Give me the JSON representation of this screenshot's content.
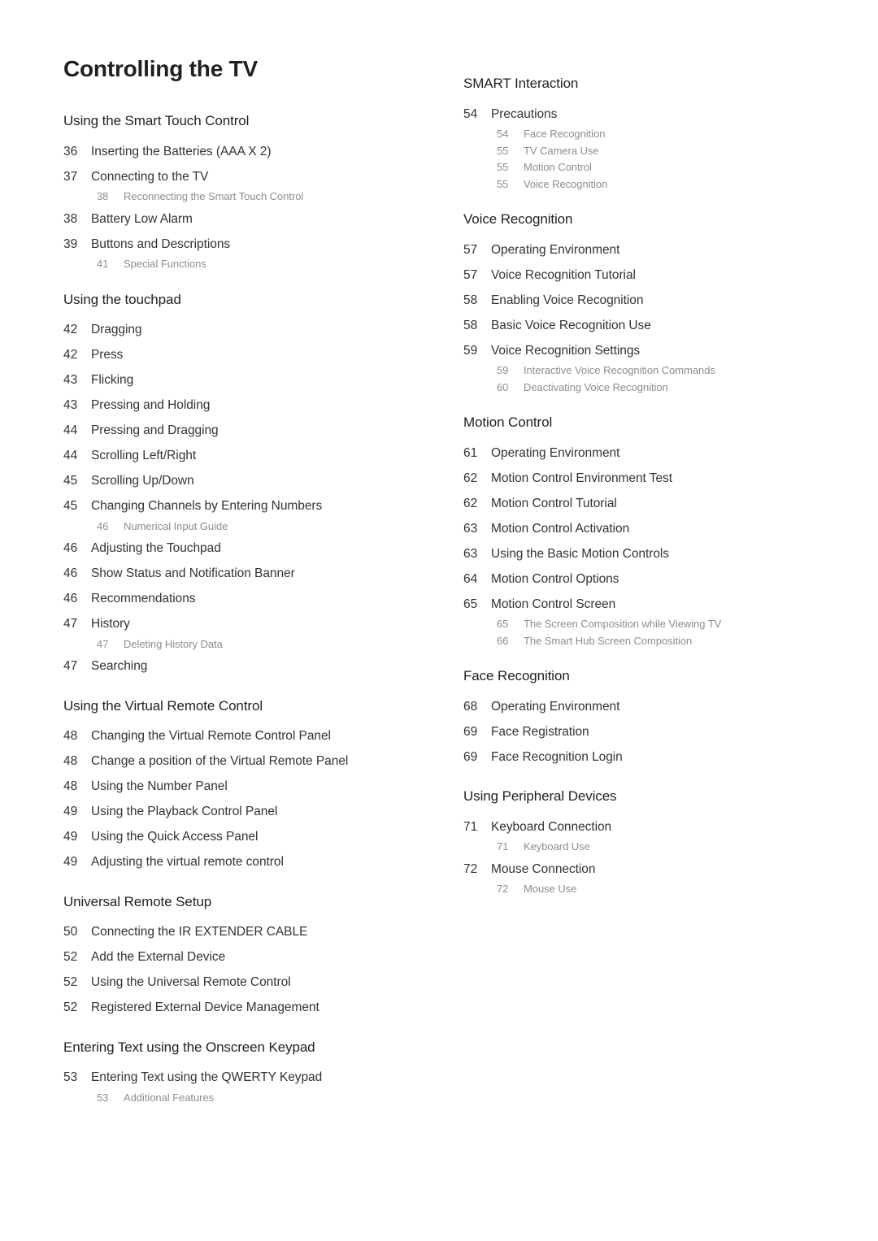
{
  "page": {
    "title": "Controlling the TV"
  },
  "columns": [
    {
      "name": "left",
      "sections": [
        {
          "heading": "Using the Smart Touch Control",
          "entries": [
            {
              "level": 1,
              "page": "36",
              "label": "Inserting the Batteries (AAA X 2)"
            },
            {
              "level": 1,
              "page": "37",
              "label": "Connecting to the TV"
            },
            {
              "level": 2,
              "page": "38",
              "label": "Reconnecting the Smart Touch Control"
            },
            {
              "level": 1,
              "page": "38",
              "label": "Battery Low Alarm"
            },
            {
              "level": 1,
              "page": "39",
              "label": "Buttons and Descriptions"
            },
            {
              "level": 2,
              "page": "41",
              "label": "Special Functions"
            }
          ]
        },
        {
          "heading": "Using the touchpad",
          "entries": [
            {
              "level": 1,
              "page": "42",
              "label": "Dragging"
            },
            {
              "level": 1,
              "page": "42",
              "label": "Press"
            },
            {
              "level": 1,
              "page": "43",
              "label": "Flicking"
            },
            {
              "level": 1,
              "page": "43",
              "label": "Pressing and Holding"
            },
            {
              "level": 1,
              "page": "44",
              "label": "Pressing and Dragging"
            },
            {
              "level": 1,
              "page": "44",
              "label": "Scrolling Left/Right"
            },
            {
              "level": 1,
              "page": "45",
              "label": "Scrolling Up/Down"
            },
            {
              "level": 1,
              "page": "45",
              "label": "Changing Channels by Entering Numbers"
            },
            {
              "level": 2,
              "page": "46",
              "label": "Numerical Input Guide"
            },
            {
              "level": 1,
              "page": "46",
              "label": "Adjusting the Touchpad"
            },
            {
              "level": 1,
              "page": "46",
              "label": "Show Status and Notification Banner"
            },
            {
              "level": 1,
              "page": "46",
              "label": "Recommendations"
            },
            {
              "level": 1,
              "page": "47",
              "label": "History"
            },
            {
              "level": 2,
              "page": "47",
              "label": "Deleting History Data"
            },
            {
              "level": 1,
              "page": "47",
              "label": "Searching"
            }
          ]
        },
        {
          "heading": "Using the Virtual Remote Control",
          "entries": [
            {
              "level": 1,
              "page": "48",
              "label": "Changing the Virtual Remote Control Panel"
            },
            {
              "level": 1,
              "page": "48",
              "label": "Change a position of the Virtual Remote Panel"
            },
            {
              "level": 1,
              "page": "48",
              "label": "Using the Number Panel"
            },
            {
              "level": 1,
              "page": "49",
              "label": "Using the Playback Control Panel"
            },
            {
              "level": 1,
              "page": "49",
              "label": "Using the Quick Access Panel"
            },
            {
              "level": 1,
              "page": "49",
              "label": "Adjusting the virtual remote control"
            }
          ]
        },
        {
          "heading": "Universal Remote Setup",
          "entries": [
            {
              "level": 1,
              "page": "50",
              "label": "Connecting the IR EXTENDER CABLE"
            },
            {
              "level": 1,
              "page": "52",
              "label": "Add the External Device"
            },
            {
              "level": 1,
              "page": "52",
              "label": "Using the Universal Remote Control"
            },
            {
              "level": 1,
              "page": "52",
              "label": "Registered External Device Management"
            }
          ]
        },
        {
          "heading": "Entering Text using the Onscreen Keypad",
          "entries": [
            {
              "level": 1,
              "page": "53",
              "label": "Entering Text using the QWERTY Keypad"
            },
            {
              "level": 2,
              "page": "53",
              "label": "Additional Features"
            }
          ]
        }
      ]
    },
    {
      "name": "right",
      "sections": [
        {
          "heading": "SMART Interaction",
          "entries": [
            {
              "level": 1,
              "page": "54",
              "label": "Precautions"
            },
            {
              "level": 2,
              "page": "54",
              "label": "Face Recognition"
            },
            {
              "level": 2,
              "page": "55",
              "label": "TV Camera Use"
            },
            {
              "level": 2,
              "page": "55",
              "label": "Motion Control"
            },
            {
              "level": 2,
              "page": "55",
              "label": "Voice Recognition"
            }
          ]
        },
        {
          "heading": "Voice Recognition",
          "entries": [
            {
              "level": 1,
              "page": "57",
              "label": "Operating Environment"
            },
            {
              "level": 1,
              "page": "57",
              "label": "Voice Recognition Tutorial"
            },
            {
              "level": 1,
              "page": "58",
              "label": "Enabling Voice Recognition"
            },
            {
              "level": 1,
              "page": "58",
              "label": "Basic Voice Recognition Use"
            },
            {
              "level": 1,
              "page": "59",
              "label": "Voice Recognition Settings"
            },
            {
              "level": 2,
              "page": "59",
              "label": "Interactive Voice Recognition Commands"
            },
            {
              "level": 2,
              "page": "60",
              "label": "Deactivating Voice Recognition"
            }
          ]
        },
        {
          "heading": "Motion Control",
          "entries": [
            {
              "level": 1,
              "page": "61",
              "label": "Operating Environment"
            },
            {
              "level": 1,
              "page": "62",
              "label": "Motion Control Environment Test"
            },
            {
              "level": 1,
              "page": "62",
              "label": "Motion Control Tutorial"
            },
            {
              "level": 1,
              "page": "63",
              "label": "Motion Control Activation"
            },
            {
              "level": 1,
              "page": "63",
              "label": "Using the Basic Motion Controls"
            },
            {
              "level": 1,
              "page": "64",
              "label": "Motion Control Options"
            },
            {
              "level": 1,
              "page": "65",
              "label": "Motion Control Screen"
            },
            {
              "level": 2,
              "page": "65",
              "label": "The Screen Composition while Viewing TV"
            },
            {
              "level": 2,
              "page": "66",
              "label": "The Smart Hub Screen Composition"
            }
          ]
        },
        {
          "heading": "Face Recognition",
          "entries": [
            {
              "level": 1,
              "page": "68",
              "label": "Operating Environment"
            },
            {
              "level": 1,
              "page": "69",
              "label": "Face Registration"
            },
            {
              "level": 1,
              "page": "69",
              "label": "Face Recognition Login"
            }
          ]
        },
        {
          "heading": "Using Peripheral Devices",
          "entries": [
            {
              "level": 1,
              "page": "71",
              "label": "Keyboard Connection"
            },
            {
              "level": 2,
              "page": "71",
              "label": "Keyboard Use"
            },
            {
              "level": 1,
              "page": "72",
              "label": "Mouse Connection"
            },
            {
              "level": 2,
              "page": "72",
              "label": "Mouse Use"
            }
          ]
        }
      ]
    }
  ]
}
